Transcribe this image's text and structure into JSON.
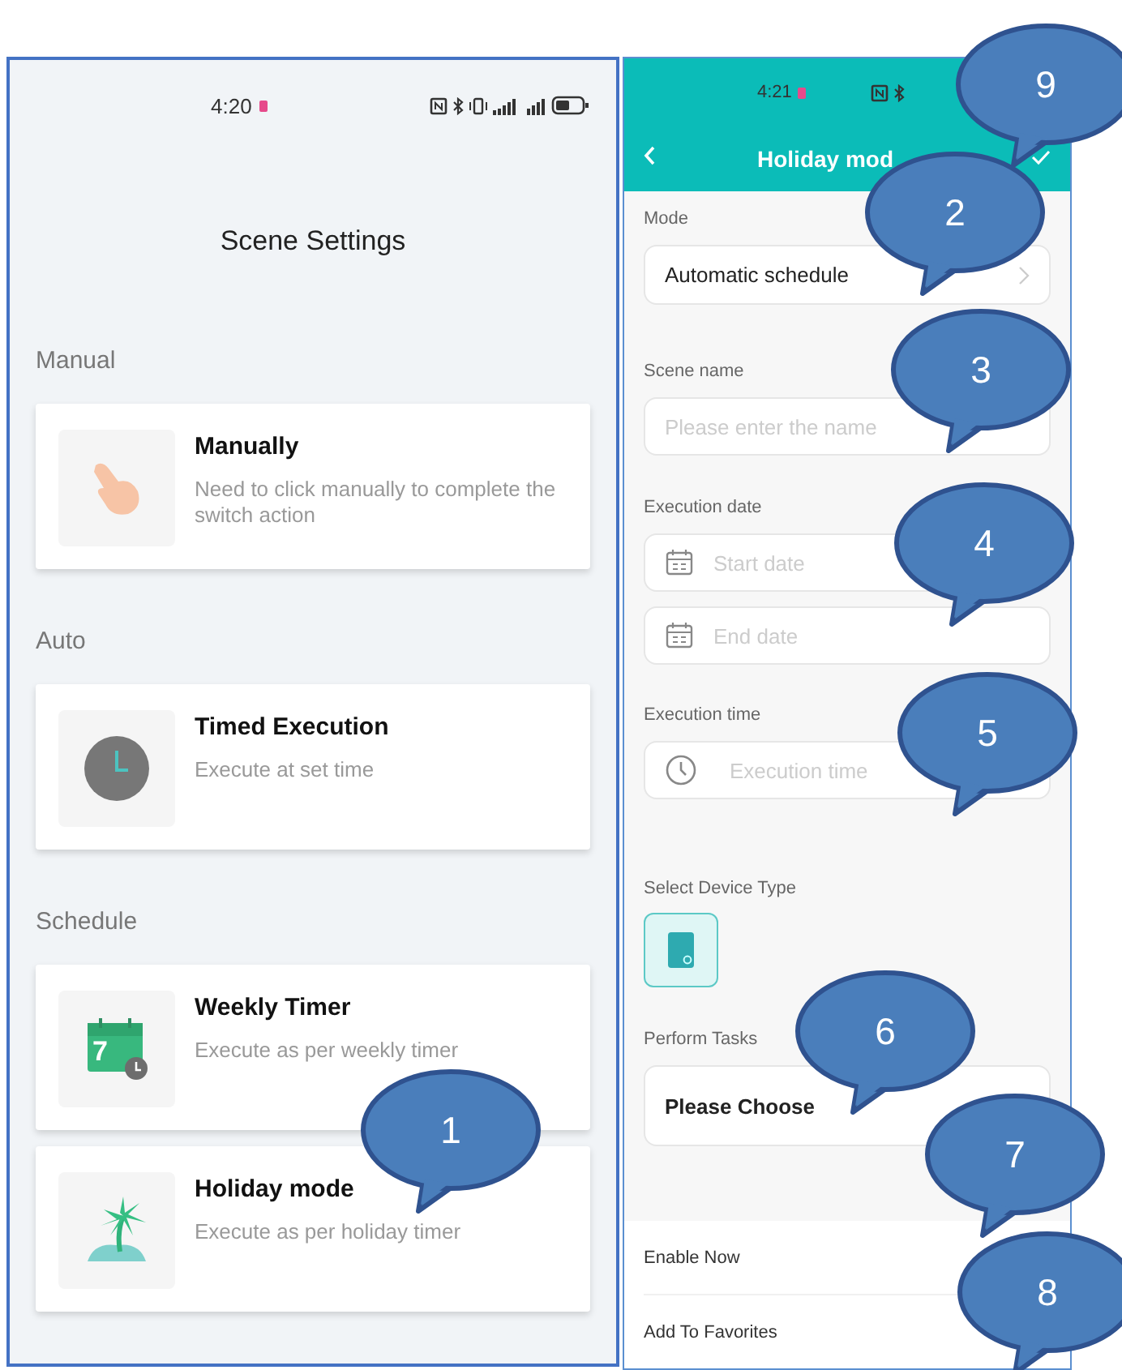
{
  "left_screen": {
    "status_bar": {
      "time": "4:20"
    },
    "title": "Scene Settings",
    "sections": [
      {
        "heading": "Manual",
        "cards": [
          {
            "kind": "hand",
            "title": "Manually",
            "description": "Need to click manually to complete the switch action"
          }
        ]
      },
      {
        "heading": "Auto",
        "cards": [
          {
            "kind": "clock",
            "title": "Timed Execution",
            "description": "Execute at set time"
          }
        ]
      },
      {
        "heading": "Schedule",
        "cards": [
          {
            "kind": "calendar",
            "icon_text": "7",
            "title": "Weekly Timer",
            "description": "Execute as per weekly timer"
          },
          {
            "kind": "palm",
            "title": "Holiday mode",
            "description": "Execute as per holiday timer"
          }
        ]
      }
    ]
  },
  "right_screen": {
    "status_bar": {
      "time": "4:21"
    },
    "title": "Holiday mod",
    "form": [
      {
        "kind": "select",
        "label": "Mode",
        "value": "Automatic schedule"
      },
      {
        "kind": "text",
        "label": "Scene name",
        "placeholder": "Please enter the name"
      },
      {
        "kind": "date",
        "label": "Execution date",
        "placeholders": [
          "Start date",
          "End date"
        ]
      },
      {
        "kind": "time",
        "label": "Execution time",
        "placeholder": "Execution time"
      },
      {
        "kind": "device",
        "label": "Select Device Type"
      },
      {
        "kind": "tasks",
        "label": "Perform Tasks",
        "value": "Please Choose"
      }
    ],
    "options": [
      {
        "label": "Enable Now"
      },
      {
        "label": "Add To Favorites"
      }
    ]
  },
  "callouts": [
    {
      "label": "1"
    },
    {
      "label": "9"
    },
    {
      "label": "2"
    },
    {
      "label": "3"
    },
    {
      "label": "4"
    },
    {
      "label": "5"
    },
    {
      "label": "6"
    },
    {
      "label": "7"
    },
    {
      "label": "8"
    }
  ]
}
